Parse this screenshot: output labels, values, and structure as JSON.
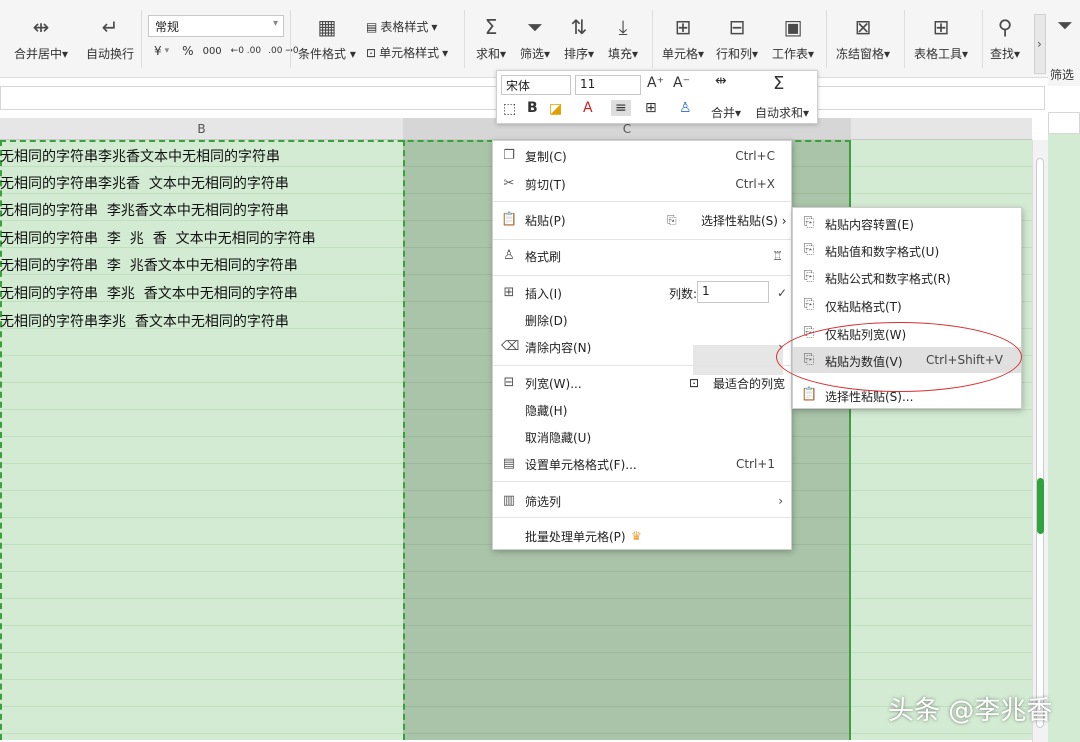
{
  "ribbon": {
    "merge_center": "合并居中",
    "merge_center_arrow": "▾",
    "wrap_text": "自动换行",
    "number_format": "常规",
    "currency": "¥",
    "percent": "%",
    "thousands": "000",
    "dec_inc": "←0 .00",
    "dec_dec": ".00 →0",
    "cond_format": "条件格式",
    "table_style": "表格样式",
    "cell_style": "单元格样式",
    "sum": "求和",
    "filter": "筛选",
    "sort": "排序",
    "fill": "填充",
    "cell": "单元格",
    "row_col": "行和列",
    "worksheet": "工作表",
    "freeze": "冻结窗格",
    "table_tools": "表格工具",
    "find": "查找",
    "filter_right": "筛选"
  },
  "sheet": {
    "col_b": "B",
    "col_c": "C",
    "rows": [
      "无相同的字符串李兆香文本中无相同的字符串",
      "无相同的字符串李兆香  文本中无相同的字符串",
      "无相同的字符串  李兆香文本中无相同的字符串",
      "无相同的字符串  李  兆  香  文本中无相同的字符串",
      "无相同的字符串  李  兆香文本中无相同的字符串",
      "无相同的字符串  李兆  香文本中无相同的字符串",
      "无相同的字符串李兆  香文本中无相同的字符串"
    ]
  },
  "mini_toolbar": {
    "font": "宋体",
    "size": "11",
    "grow": "A⁺",
    "shrink": "A⁻",
    "bold": "B",
    "merge": "合并",
    "autosum": "自动求和"
  },
  "context_menu": {
    "copy": "复制(C)",
    "copy_sc": "Ctrl+C",
    "cut": "剪切(T)",
    "cut_sc": "Ctrl+X",
    "paste": "粘贴(P)",
    "paste_special": "选择性粘贴(S)",
    "format_painter": "格式刷",
    "insert": "插入(I)",
    "col_count_label": "列数:",
    "col_count_value": "1",
    "delete": "删除(D)",
    "clear": "清除内容(N)",
    "col_width": "列宽(W)...",
    "best_fit": "最适合的列宽",
    "hide": "隐藏(H)",
    "unhide": "取消隐藏(U)",
    "format_cells": "设置单元格格式(F)...",
    "format_cells_sc": "Ctrl+1",
    "filter_col": "筛选列",
    "batch": "批量处理单元格(P)"
  },
  "paste_submenu": {
    "transpose": "粘贴内容转置(E)",
    "values_numfmt": "粘贴值和数字格式(U)",
    "formulas_numfmt": "粘贴公式和数字格式(R)",
    "formats_only": "仅粘贴格式(T)",
    "col_width_only": "仅粘贴列宽(W)",
    "as_values": "粘贴为数值(V)",
    "as_values_sc": "Ctrl+Shift+V",
    "special": "选择性粘贴(S)..."
  },
  "watermark": "头条 @李兆香",
  "colors": {
    "accent_green": "#2fa43c",
    "selection_fill": "#a9c4a9",
    "highlight_red": "#d93030"
  }
}
